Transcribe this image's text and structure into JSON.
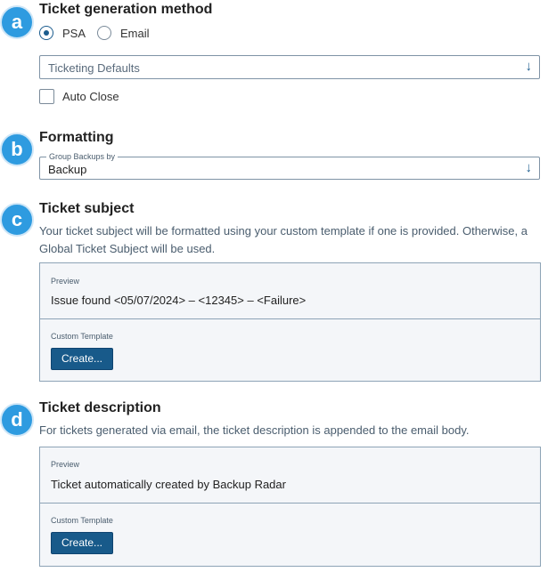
{
  "sections": {
    "a": {
      "badge": "a",
      "title": "Ticket generation method",
      "radio_options": [
        "PSA",
        "Email"
      ],
      "selected_option": "PSA",
      "ticketing_select": {
        "value": "Ticketing Defaults"
      },
      "auto_close": {
        "label": "Auto Close",
        "checked": false
      }
    },
    "b": {
      "badge": "b",
      "title": "Formatting",
      "group_select": {
        "label": "Group Backups by",
        "value": "Backup"
      }
    },
    "c": {
      "badge": "c",
      "title": "Ticket subject",
      "description": "Your ticket subject will be formatted using your custom template if one is provided. Otherwise, a Global Ticket Subject will be used.",
      "preview_label": "Preview",
      "preview_value": "Issue found <05/07/2024> – <12345> – <Failure>",
      "template_label": "Custom Template",
      "create_label": "Create..."
    },
    "d": {
      "badge": "d",
      "title": "Ticket description",
      "description": "For tickets generated via email, the ticket description is appended to the email body.",
      "preview_label": "Preview",
      "preview_value": "Ticket automatically created by Backup Radar",
      "template_label": "Custom Template",
      "create_label": "Create..."
    }
  },
  "icons": {
    "select_arrow": "arrow-down-icon"
  },
  "colors": {
    "badge": "#2e9be0",
    "button": "#185a8a",
    "panel_bg": "#f4f6f9",
    "border": "#8da3b6"
  }
}
